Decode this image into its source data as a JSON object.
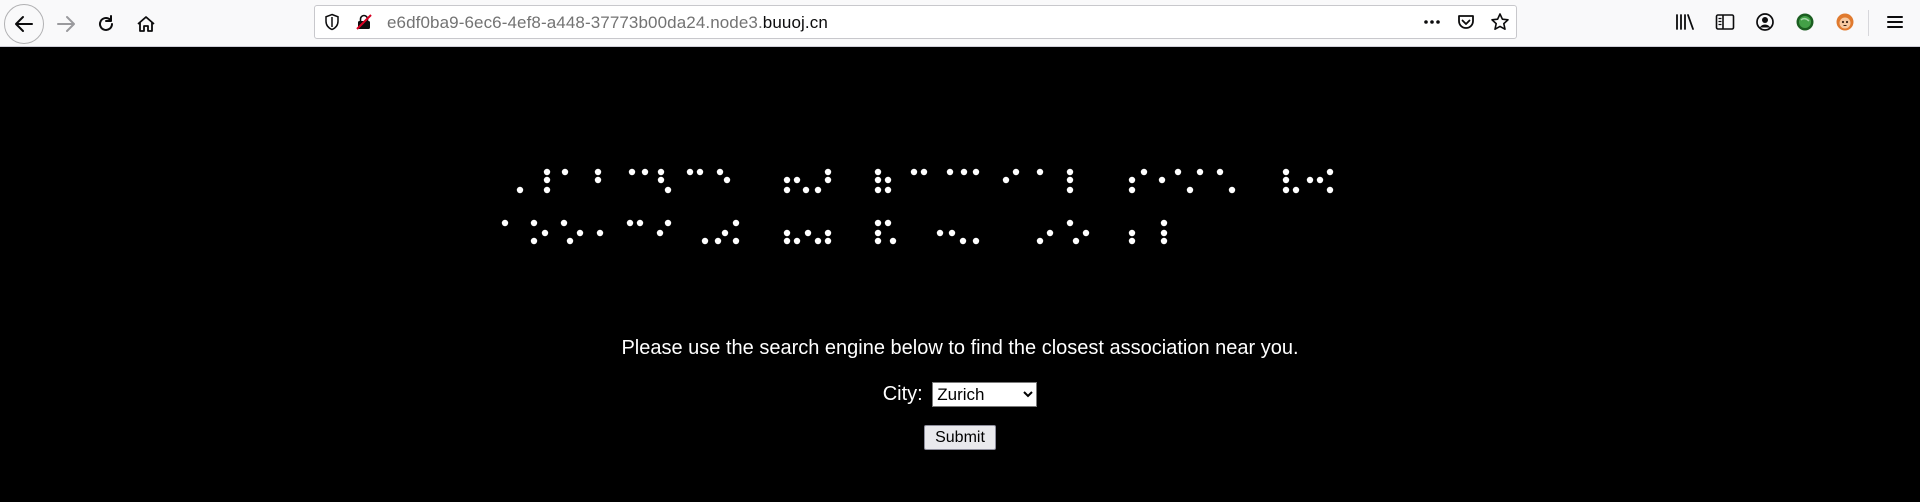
{
  "browser": {
    "url_prefix": "e6df0ba9-6ec6-4ef8-a448-37773b00da24.node3.",
    "url_domain": "buuoj.cn",
    "icons": {
      "back": "back-arrow-icon",
      "forward": "forward-arrow-icon",
      "reload": "reload-icon",
      "home": "home-icon",
      "tracking": "tracking-protection-shield-icon",
      "insecure": "insecure-connection-icon",
      "page_actions": "more-dots-icon",
      "pocket": "pocket-icon",
      "bookmark": "star-icon",
      "library": "library-icon",
      "sidebar": "sidebar-icon",
      "account": "account-icon",
      "extension1": "green-globe-extension-icon",
      "extension2": "monkey-extension-icon",
      "menu": "hamburger-menu-icon"
    }
  },
  "page": {
    "braille_banner": "braille-title-image",
    "intro_text": "Please use the search engine below to find the closest association near you.",
    "city_label": "City:",
    "city_selected": "Zurich",
    "submit_label": "Submit"
  }
}
